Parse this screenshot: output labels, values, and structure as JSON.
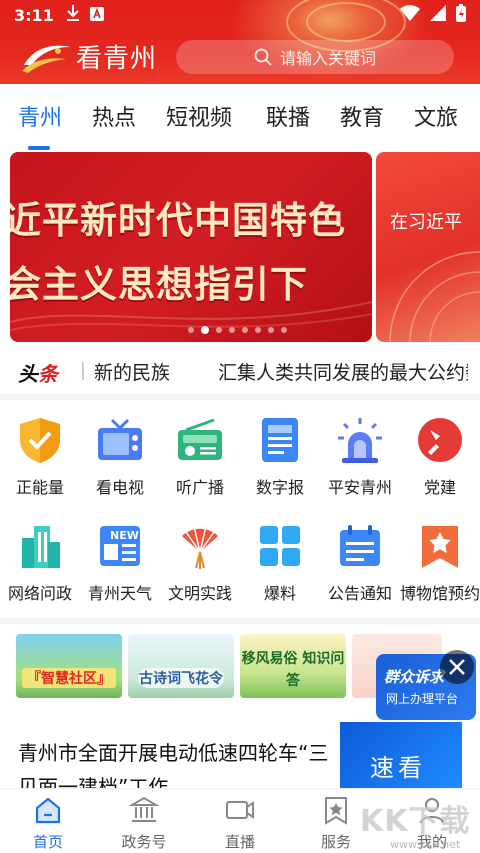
{
  "status_bar": {
    "time": "3:11"
  },
  "header": {
    "app_name": "看青州",
    "search_placeholder": "请输入关键词"
  },
  "tabs": [
    {
      "label": "青州",
      "active": true
    },
    {
      "label": "热点"
    },
    {
      "label": "短视频"
    },
    {
      "label": "联播"
    },
    {
      "label": "教育"
    },
    {
      "label": "文旅"
    }
  ],
  "banner": {
    "line1": "近平新时代中国特色",
    "line2": "会主义思想指引下",
    "next_preview": "在习近平",
    "slide_count": 8,
    "active_slide": 2
  },
  "headline": {
    "tag_part1": "头",
    "tag_part2": "条",
    "item1": "新的民族",
    "item2": "汇集人类共同发展的最大公约数"
  },
  "services_row1": [
    {
      "label": "正能量",
      "icon": "shield-check-icon"
    },
    {
      "label": "看电视",
      "icon": "tv-icon"
    },
    {
      "label": "听广播",
      "icon": "radio-icon"
    },
    {
      "label": "数字报",
      "icon": "newspaper-icon"
    },
    {
      "label": "平安青州",
      "icon": "police-light-icon"
    },
    {
      "label": "党建",
      "icon": "party-emblem-icon"
    }
  ],
  "services_row2": [
    {
      "label": "网络问政",
      "icon": "building-icon"
    },
    {
      "label": "青州天气",
      "icon": "news-icon"
    },
    {
      "label": "文明实践",
      "icon": "fan-icon"
    },
    {
      "label": "爆料",
      "icon": "grid-icon"
    },
    {
      "label": "公告通知",
      "icon": "calendar-icon"
    },
    {
      "label": "博物馆预约",
      "icon": "star-bookmark-icon"
    }
  ],
  "thumbnails": [
    {
      "caption": "『智慧社区』"
    },
    {
      "caption": "古诗词飞花令"
    },
    {
      "caption": "移风易俗 知识问答"
    },
    {
      "caption": ""
    }
  ],
  "float_card": {
    "line1": "群众诉求",
    "line2": "网上办理平台"
  },
  "article": {
    "title": "青州市全面开展电动低速四轮车“三见面一建档”工作",
    "image_text": "速看"
  },
  "bottom_nav": [
    {
      "label": "首页",
      "active": true
    },
    {
      "label": "政务号"
    },
    {
      "label": "直播"
    },
    {
      "label": "服务"
    },
    {
      "label": "我的"
    }
  ],
  "watermark": {
    "text": "KK下载",
    "url": "www.kkx.net"
  },
  "colors": {
    "brand_red": "#e0201c",
    "accent_blue": "#1a73e8"
  }
}
